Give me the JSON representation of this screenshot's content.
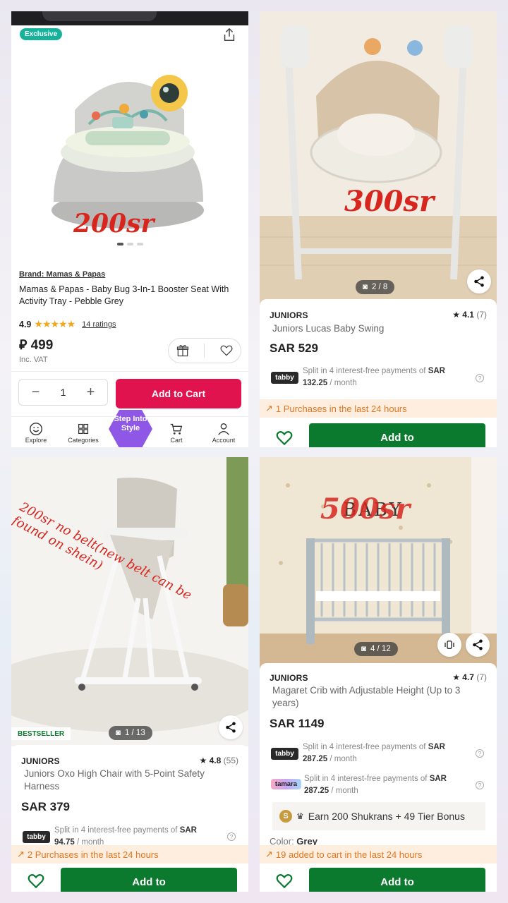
{
  "panel1": {
    "badge": "Exclusive",
    "annotation": "200sr",
    "brand": "Brand: Mamas & Papas",
    "title": "Mamas & Papas - Baby Bug 3-In-1 Booster Seat With Activity Tray - Pebble Grey",
    "rating": "4.9",
    "ratings_link": "14 ratings",
    "price": "⃁ 499",
    "vat": "Inc. VAT",
    "qty": "1",
    "add_to_cart": "Add to Cart",
    "nav": {
      "explore": "Explore",
      "categories": "Categories",
      "step": "Step Into Style",
      "cart": "Cart",
      "account": "Account"
    }
  },
  "panel2": {
    "annotation": "300sr",
    "counter": "2 / 8",
    "brand": "JUNIORS",
    "rating": "4.1",
    "rating_count": "(7)",
    "name": "Juniors Lucas Baby Swing",
    "price": "SAR 529",
    "tabby_logo": "tabby",
    "split_prefix": "Split in 4 interest-free payments of ",
    "split_currency": "SAR",
    "split_amount": "132.25",
    "split_suffix": " / month",
    "purchases": "1 Purchases in the last 24 hours",
    "add_to": "Add to"
  },
  "panel3": {
    "annotation": "200sr no belt(new belt can be found on shein)",
    "counter": "1 / 13",
    "bestseller": "BESTSELLER",
    "brand": "JUNIORS",
    "rating": "4.8",
    "rating_count": "(55)",
    "name": "Juniors Oxo High Chair with 5-Point Safety Harness",
    "price": "SAR 379",
    "tabby_logo": "tabby",
    "split_prefix": "Split in 4 interest-free payments of ",
    "split_currency": "SAR",
    "split_amount": "94.75",
    "split_suffix": " / month",
    "purchases": "2 Purchases in the last 24 hours",
    "add_to": "Add to"
  },
  "panel4": {
    "annotation": "500sr",
    "wall_text": "BABY",
    "counter": "4 / 12",
    "brand": "JUNIORS",
    "rating": "4.7",
    "rating_count": "(7)",
    "name": "Magaret Crib with Adjustable Height (Up to 3 years)",
    "price": "SAR 1149",
    "tabby_logo": "tabby",
    "tamara_logo": "tamara",
    "split_prefix": "Split in 4 interest-free payments of ",
    "split_currency": "SAR",
    "split_amount_tabby": "287.25",
    "split_amount_tamara": "287.25",
    "split_suffix": " / month",
    "shukrans": "Earn 200 Shukrans + 49 Tier Bonus",
    "coin": "S",
    "color_label": "Color: ",
    "color_value": "Grey",
    "added": "19 added to cart in the last 24 hours",
    "add_to": "Add to"
  },
  "colors": {
    "exclusive": "#16b39a",
    "add_cart_pink": "#e0134f",
    "add_green": "#0b7a2e",
    "purchases_text": "#e4761e",
    "purchases_bg": "#fdeee0",
    "step_hex": "#8e57e6",
    "annotation_red": "#d8261f"
  }
}
